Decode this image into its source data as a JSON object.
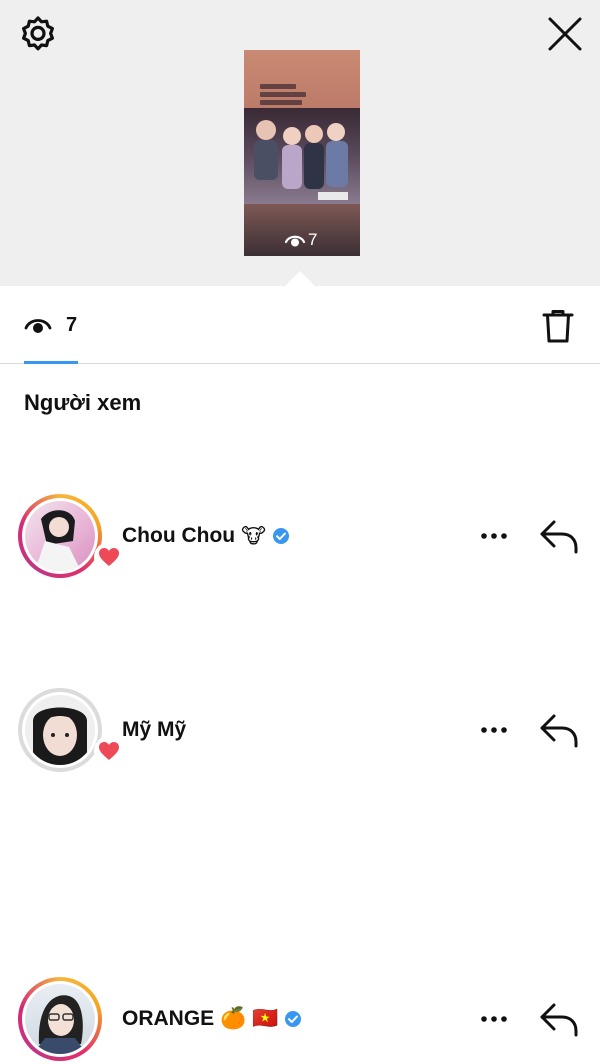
{
  "header": {
    "settings_icon": "gear-icon",
    "close_icon": "close-icon",
    "background": "#efefef"
  },
  "story_thumbnail": {
    "view_count": "7",
    "eye_icon": "eye-icon"
  },
  "tabs": {
    "views_count": "7",
    "views_icon": "eye-icon",
    "delete_icon": "trash-icon",
    "active_color": "#3897f0"
  },
  "viewers": {
    "title": "Người xem",
    "items": [
      {
        "name": "Chou Chou",
        "emoji": "🐮",
        "verified": true,
        "liked": true,
        "story_ring": true
      },
      {
        "name": "Mỹ Mỹ",
        "emoji": "",
        "verified": false,
        "liked": true,
        "story_ring": false
      },
      {
        "name": "ORANGE",
        "emoji": "🍊 🇻🇳",
        "verified": true,
        "liked": false,
        "story_ring": true
      }
    ],
    "heart_color": "#ed4956",
    "verified_color": "#3897f0"
  }
}
